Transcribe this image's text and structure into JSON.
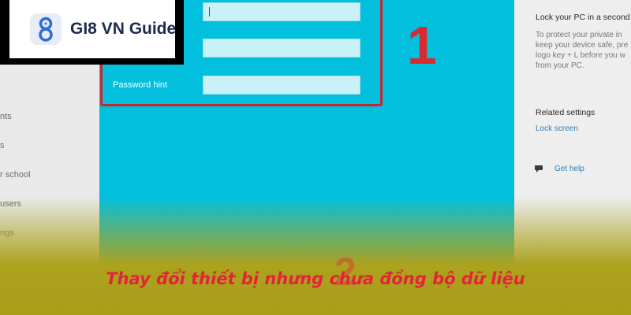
{
  "brand": {
    "name": "GI8 VN Guide",
    "accent": "#1b2a4e"
  },
  "step_markers": {
    "first": "1",
    "second": "2"
  },
  "form": {
    "fields": [
      {
        "value": ""
      },
      {
        "value": ""
      },
      {
        "label": "Password hint",
        "value": ""
      }
    ],
    "highlight_color": "#c8262e"
  },
  "left_nav": {
    "items": [
      "nts",
      "s",
      "r school",
      "users",
      "ngs"
    ]
  },
  "right_pane": {
    "heading": "Lock your PC in a second",
    "body_lines": [
      "To protect your private in",
      "keep your device safe, pre",
      "logo key + L before you w",
      "from your PC."
    ],
    "related_title": "Related settings",
    "related_link": "Lock screen",
    "help_link": "Get help",
    "help_icon": "chat-help-icon"
  },
  "caption": "Thay đổi thiết bị nhưng chưa đồng bộ dữ liệu"
}
